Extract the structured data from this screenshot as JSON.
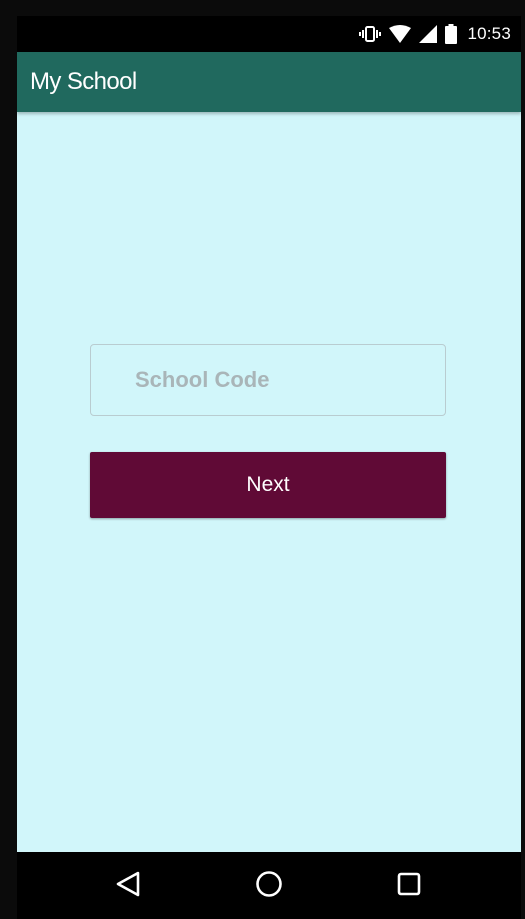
{
  "status_bar": {
    "time": "10:53",
    "icons": [
      "vibrate-icon",
      "wifi-icon",
      "signal-icon",
      "battery-icon"
    ]
  },
  "app_bar": {
    "title": "My School"
  },
  "form": {
    "school_code": {
      "value": "",
      "placeholder": "School Code"
    },
    "next_label": "Next"
  },
  "nav_bar": {
    "icons": [
      "back-icon",
      "home-icon",
      "recents-icon"
    ]
  },
  "colors": {
    "app_bar": "#20695e",
    "background": "#d1f6fa",
    "button": "#600a36",
    "input_border": "#b9ccd0",
    "placeholder": "#a9b5b8"
  }
}
